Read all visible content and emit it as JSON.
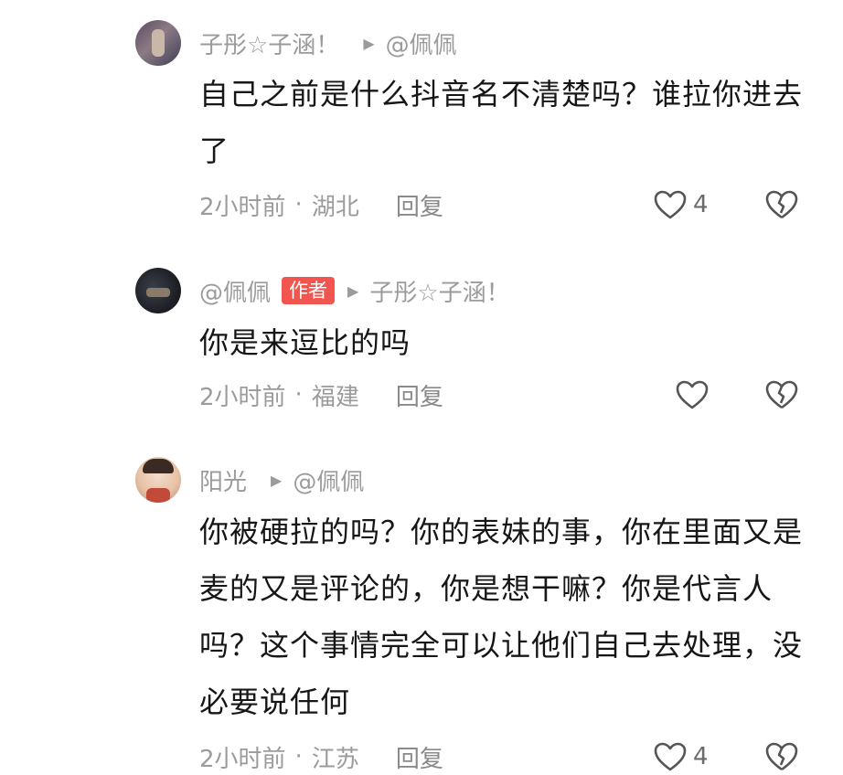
{
  "comments": [
    {
      "user": "子彤☆子涵！",
      "reply_to": "@佩佩",
      "text": "自己之前是什么抖音名不清楚吗？谁拉你进去了",
      "time": "2小时前",
      "location": "湖北",
      "reply_label": "回复",
      "likes": "4"
    },
    {
      "user": "@佩佩",
      "tag": "作者",
      "reply_to": "子彤☆子涵！",
      "text": "你是来逗比的吗",
      "time": "2小时前",
      "location": "福建",
      "reply_label": "回复",
      "likes": ""
    },
    {
      "user": "阳光",
      "reply_to": "@佩佩",
      "text": "你被硬拉的吗？你的表妹的事，你在里面又是麦的又是评论的，你是想干嘛？你是代言人吗？这个事情完全可以让他们自己去处理，没必要说任何",
      "time": "2小时前",
      "location": "江苏",
      "reply_label": "回复",
      "likes": "4"
    }
  ],
  "separator": "·",
  "icons": {
    "like": "heart-outline-icon",
    "dislike": "broken-heart-icon",
    "reply_arrow": "play-triangle-icon"
  },
  "colors": {
    "text": "#161616",
    "meta": "#9b9b9b",
    "author_tag": "#f2554f"
  }
}
